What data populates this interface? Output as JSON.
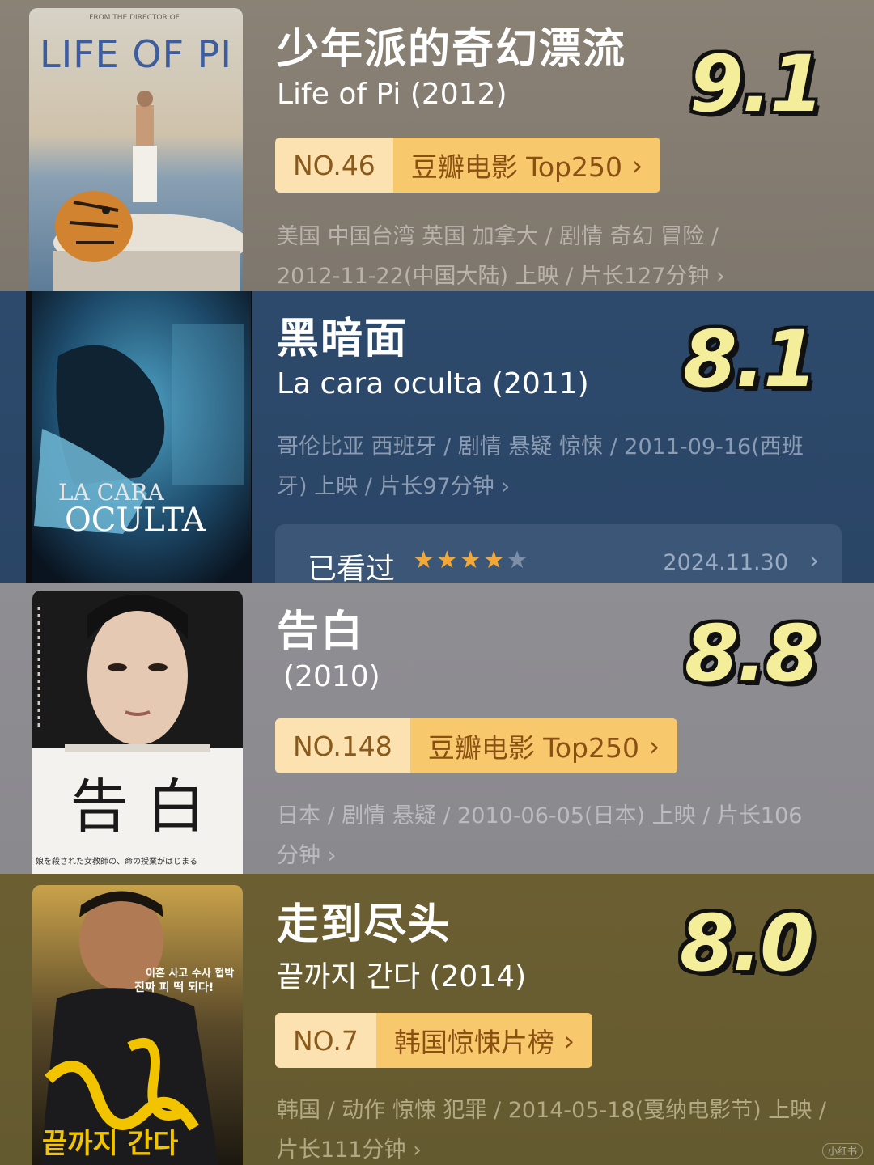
{
  "movies": [
    {
      "title_cn": "少年派的奇幻漂流",
      "title_orig": "Life of Pi (2012)",
      "score": "9.1",
      "rank_no": "NO.46",
      "rank_list": "豆瓣电影 Top250",
      "meta_line1": "美国 中国台湾 英国 加拿大 / 剧情 奇幻 冒险 /",
      "meta_line2": "2012-11-22(中国大陆) 上映 / 片长127分钟 ›",
      "poster_text": "LIFE OF PI",
      "poster_top_text": "FROM THE DIRECTOR OF"
    },
    {
      "title_cn": "黑暗面",
      "title_orig": "La cara oculta (2011)",
      "score": "8.1",
      "meta_line1": "哥伦比亚 西班牙 / 剧情 悬疑 惊悚 / 2011-09-16(西班",
      "meta_line2": "牙) 上映 / 片长97分钟 ›",
      "poster_text_1": "LA CARA",
      "poster_text_2": "OCULTA",
      "watched_label": "已看过",
      "watched_rating": 4,
      "watched_rating_max": 5,
      "watched_date": "2024.11.30",
      "chevron": "›"
    },
    {
      "title_cn": "告白",
      "title_orig": "(2010)",
      "score": "8.8",
      "rank_no": "NO.148",
      "rank_list": "豆瓣电影 Top250",
      "meta_line1": "日本 / 剧情 悬疑 / 2010-06-05(日本) 上映 / 片长106",
      "meta_line2": "分钟 ›",
      "poster_text": "告 白",
      "poster_caption": "娘を殺された女教師の、命の授業がはじまる"
    },
    {
      "title_cn": "走到尽头",
      "title_orig": "끝까지 간다 (2014)",
      "score": "8.0",
      "rank_no": "NO.7",
      "rank_list": "韩国惊悚片榜",
      "meta_line1": "韩国 / 动作 惊悚 犯罪 / 2014-05-18(戛纳电影节) 上映 /",
      "meta_line2": "片长111分钟 ›",
      "poster_text": "끝까지 간다",
      "poster_tagline_1": "이혼 사고 수사 협박",
      "poster_tagline_2": "진짜 피 떡 되다!"
    }
  ],
  "rank_chevron": "›",
  "watermark": "小红书",
  "colors": {
    "score_fill": "#f4ee9a",
    "rank_no_bg": "#fbe2b0",
    "rank_list_bg": "#f7c86c",
    "star_on": "#f3a734"
  }
}
